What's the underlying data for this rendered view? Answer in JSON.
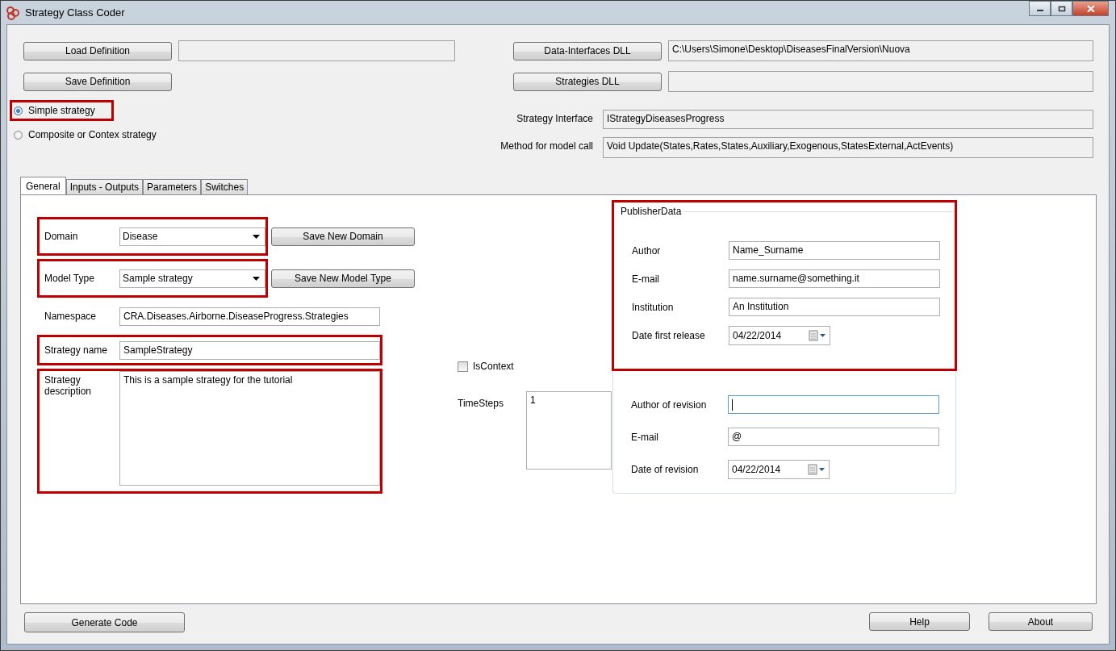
{
  "window": {
    "title": "Strategy Class Coder"
  },
  "files": [
    {
      "button": "Load Definition"
    },
    {
      "button": "Save Definition"
    }
  ],
  "dlls": [
    {
      "button": "Data-Interfaces DLL",
      "value": "C:\\Users\\Simone\\Desktop\\DiseasesFinalVersion\\Nuova"
    },
    {
      "button": "Strategies DLL"
    }
  ],
  "strategy_type": [
    {
      "label": "Simple strategy",
      "selected": true,
      "highlighted": true
    },
    {
      "label": "Composite or Contex strategy",
      "selected": false,
      "highlighted": false
    }
  ],
  "interface": [
    {
      "label": "Strategy Interface",
      "value": "IStrategyDiseasesProgress"
    },
    {
      "label": "Method for model call",
      "value": "Void Update(States,Rates,States,Auxiliary,Exogenous,StatesExternal,ActEvents)"
    }
  ],
  "tabs": [
    {
      "label": "General",
      "selected": true
    },
    {
      "label": "Inputs - Outputs",
      "selected": false
    },
    {
      "label": "Parameters",
      "selected": false
    },
    {
      "label": "Switches",
      "selected": false
    }
  ],
  "general": {
    "rows": [
      {
        "kind": "combo",
        "label": "Domain",
        "value": "Disease",
        "button": "Save New Domain",
        "highlighted": true
      },
      {
        "kind": "combo",
        "label": "Model Type",
        "value": "Sample strategy",
        "button": "Save New Model Type",
        "highlighted": true
      },
      {
        "kind": "text",
        "label": "Namespace",
        "value": "CRA.Diseases.Airborne.DiseaseProgress.Strategies",
        "highlighted": false
      },
      {
        "kind": "text",
        "label": "Strategy name",
        "value": "SampleStrategy",
        "highlighted": true
      },
      {
        "kind": "multiline",
        "label": "Strategy description",
        "value": "This is a sample strategy for the tutorial",
        "highlighted": true
      }
    ],
    "is_context": {
      "label": "IsContext",
      "checked": false
    },
    "time_steps": {
      "label": "TimeSteps",
      "value": "1"
    },
    "publisher": {
      "title": "PublisherData",
      "highlighted": true,
      "rows": [
        {
          "kind": "text",
          "label": "Author",
          "value": "Name_Surname"
        },
        {
          "kind": "text",
          "label": "E-mail",
          "value": "name.surname@something.it"
        },
        {
          "kind": "text",
          "label": "Institution",
          "value": "An Institution"
        },
        {
          "kind": "date",
          "label": "Date first release",
          "value": "04/22/2014"
        }
      ],
      "revision_rows": [
        {
          "kind": "text",
          "label": "Author of revision",
          "focused": true
        },
        {
          "kind": "text",
          "label": "E-mail",
          "value": "@",
          "focused": false
        },
        {
          "kind": "date",
          "label": "Date of revision",
          "value": "04/22/2014",
          "focused": false
        }
      ]
    }
  },
  "buttons": {
    "generate": "Generate Code",
    "help": "Help",
    "about": "About"
  }
}
